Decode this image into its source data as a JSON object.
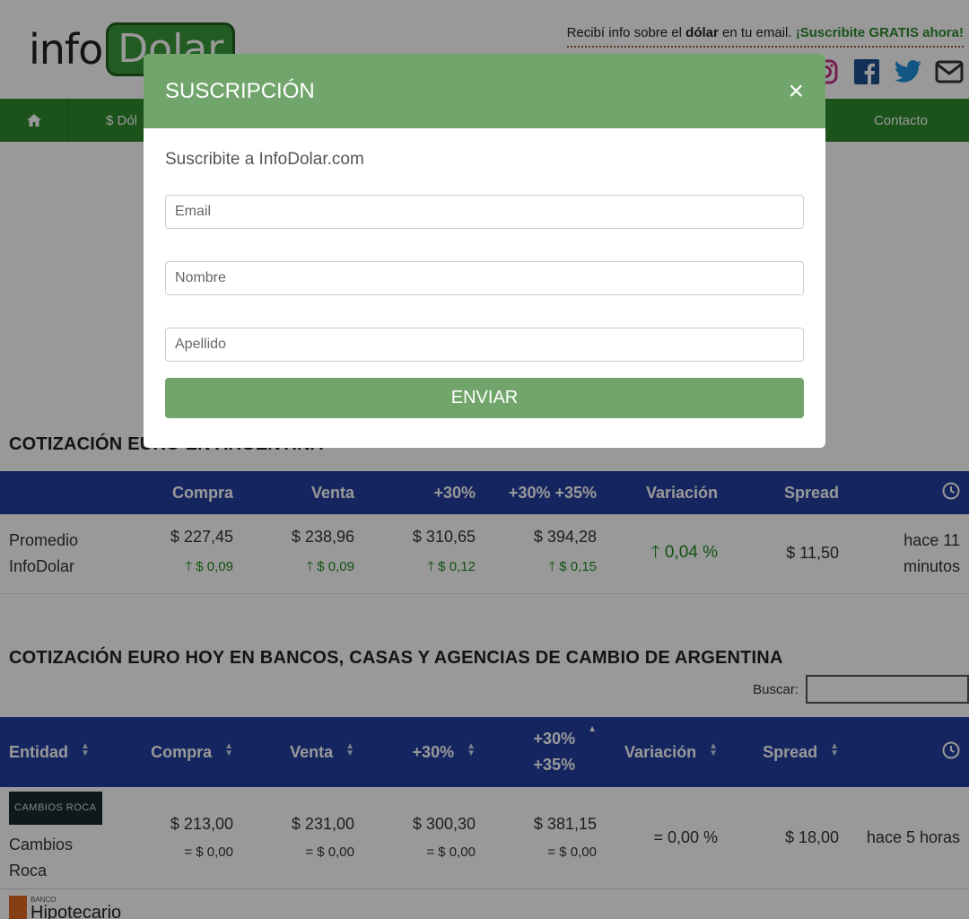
{
  "header": {
    "logo_info": "info",
    "logo_dolar": "Dolar",
    "promo_prefix": "Recibí info sobre el",
    "promo_bold": "dólar",
    "promo_mid": "en tu email.",
    "promo_cta": "¡Suscribite GRATIS ahora!"
  },
  "nav": {
    "dolar_label": "$ Dól",
    "contact_label": "Contacto"
  },
  "section1": {
    "title": "COTIZACIÓN EURO EN ARGENTINA",
    "headers": [
      "",
      "Compra",
      "Venta",
      "+30%",
      "+30% +35%",
      "Variación",
      "Spread"
    ],
    "row": {
      "name_line1": "Promedio",
      "name_line2": "InfoDolar",
      "compra": "$ 227,45",
      "compra_var": "$ 0,09",
      "venta": "$ 238,96",
      "venta_var": "$ 0,09",
      "p30": "$ 310,65",
      "p30_var": "$ 0,12",
      "p3035": "$ 394,28",
      "p3035_var": "$ 0,15",
      "variacion": "0,04 %",
      "spread": "$ 11,50",
      "time_line1": "hace 11",
      "time_line2": "minutos"
    }
  },
  "section2": {
    "title": "COTIZACIÓN EURO HOY EN BANCOS, CASAS Y AGENCIAS DE CAMBIO DE ARGENTINA",
    "search_label": "Buscar:",
    "headers": [
      "Entidad",
      "Compra",
      "Venta",
      "+30%",
      "+30%",
      "+35%",
      "Variación",
      "Spread"
    ],
    "rows": [
      {
        "logo_text": "CAMBIOS ROCA",
        "name_line1": "Cambios",
        "name_line2": "Roca",
        "compra": "$ 213,00",
        "compra_var": "= $ 0,00",
        "venta": "$ 231,00",
        "venta_var": "= $ 0,00",
        "p30": "$ 300,30",
        "p30_var": "= $ 0,00",
        "p3035": "$ 381,15",
        "p3035_var": "= $ 0,00",
        "variacion": "= 0,00 %",
        "spread": "$ 18,00",
        "time": "hace 5 horas"
      }
    ],
    "next_logo_small": "BANCO",
    "next_logo": "Hipotecario"
  },
  "modal": {
    "title": "SUSCRIPCIÓN",
    "close": "×",
    "subtitle": "Suscribite a InfoDolar.com",
    "email_placeholder": "Email",
    "nombre_placeholder": "Nombre",
    "apellido_placeholder": "Apellido",
    "submit": "ENVIAR"
  },
  "colors": {
    "brand_green": "#2e8b2e",
    "modal_green": "#72a56b",
    "table_header_blue": "#233f9f",
    "up_green": "#1f8a1f"
  }
}
